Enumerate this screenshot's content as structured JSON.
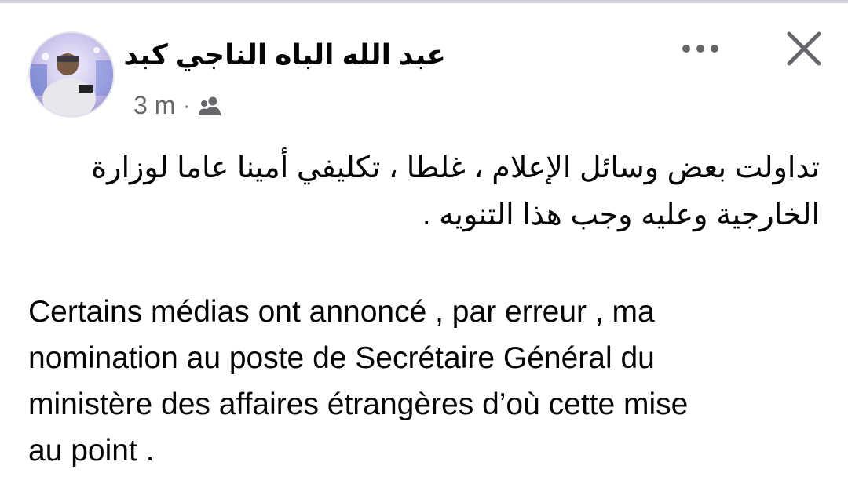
{
  "post": {
    "author_name": "عبد الله الباه الناجي كبد",
    "timestamp": "3 m",
    "separator": "·",
    "audience_icon": "friends-icon",
    "text_arabic_lines": [
      "تداولت بعض وسائل الإعلام ، غلطا ، تكليفي أمينا عاما لوزارة",
      "الخارجية وعليه وجب هذا التنويه ."
    ],
    "text_french_lines": [
      "Certains médias ont annoncé , par erreur , ma",
      "nomination au poste de Secrétaire Général du",
      "ministère des affaires étrangères d’où cette mise",
      "au point ."
    ]
  },
  "header": {
    "more_icon": "more-options-icon",
    "close_icon": "close-icon"
  },
  "colors": {
    "text_primary": "#050505",
    "text_secondary": "#65676b",
    "icon_gray": "#65676b"
  }
}
